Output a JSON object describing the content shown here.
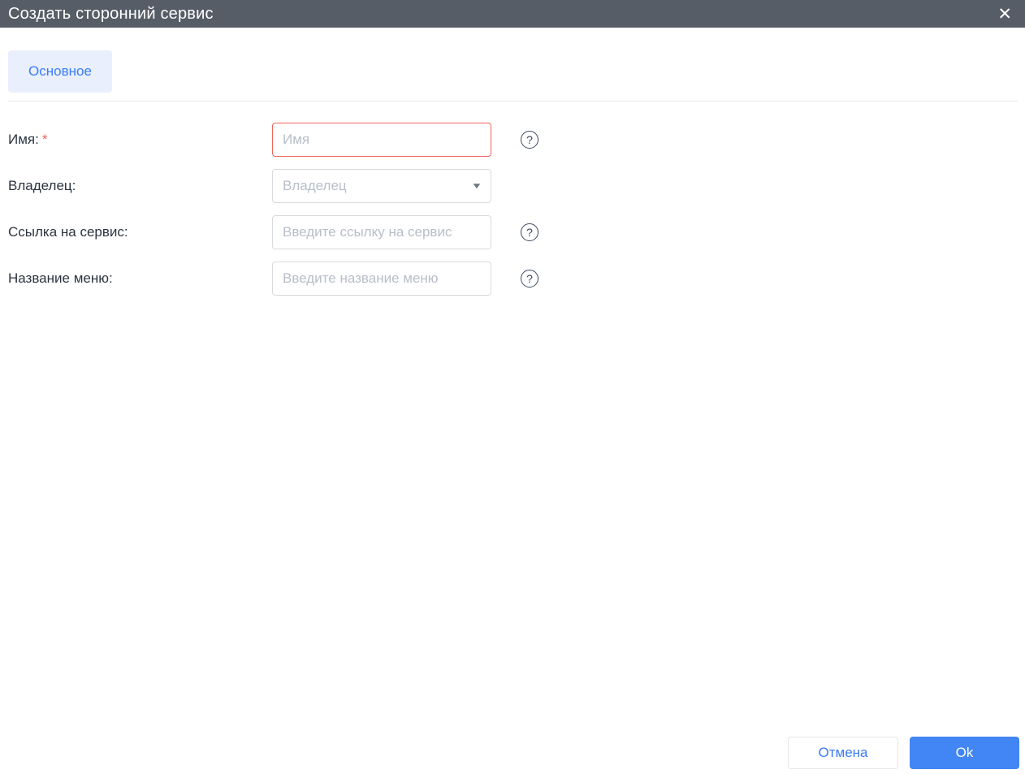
{
  "window": {
    "title": "Создать сторонний сервис"
  },
  "icons": {
    "close": "✕",
    "help": "?",
    "caret": "▼"
  },
  "tabs": {
    "main_label": "Основное"
  },
  "form": {
    "required_mark": "*",
    "fields": [
      {
        "label": "Имя:",
        "placeholder": "Имя",
        "type": "text",
        "required": true,
        "error": true
      },
      {
        "label": "Владелец:",
        "placeholder": "Владелец",
        "type": "select"
      },
      {
        "label": "Ссылка на сервис:",
        "placeholder": "Введите ссылку на сервис",
        "type": "text"
      },
      {
        "label": "Название меню:",
        "placeholder": "Введите название меню",
        "type": "text"
      }
    ]
  },
  "footer": {
    "cancel_label": "Отмена",
    "ok_label": "Ok"
  },
  "colors": {
    "titlebar_bg": "#565d66",
    "accent_blue": "#3b7cf5",
    "ok_button_bg": "#4285f4",
    "tab_bg": "#e9effc",
    "error_red": "#f2635c",
    "placeholder_gray": "#b8bec8"
  }
}
